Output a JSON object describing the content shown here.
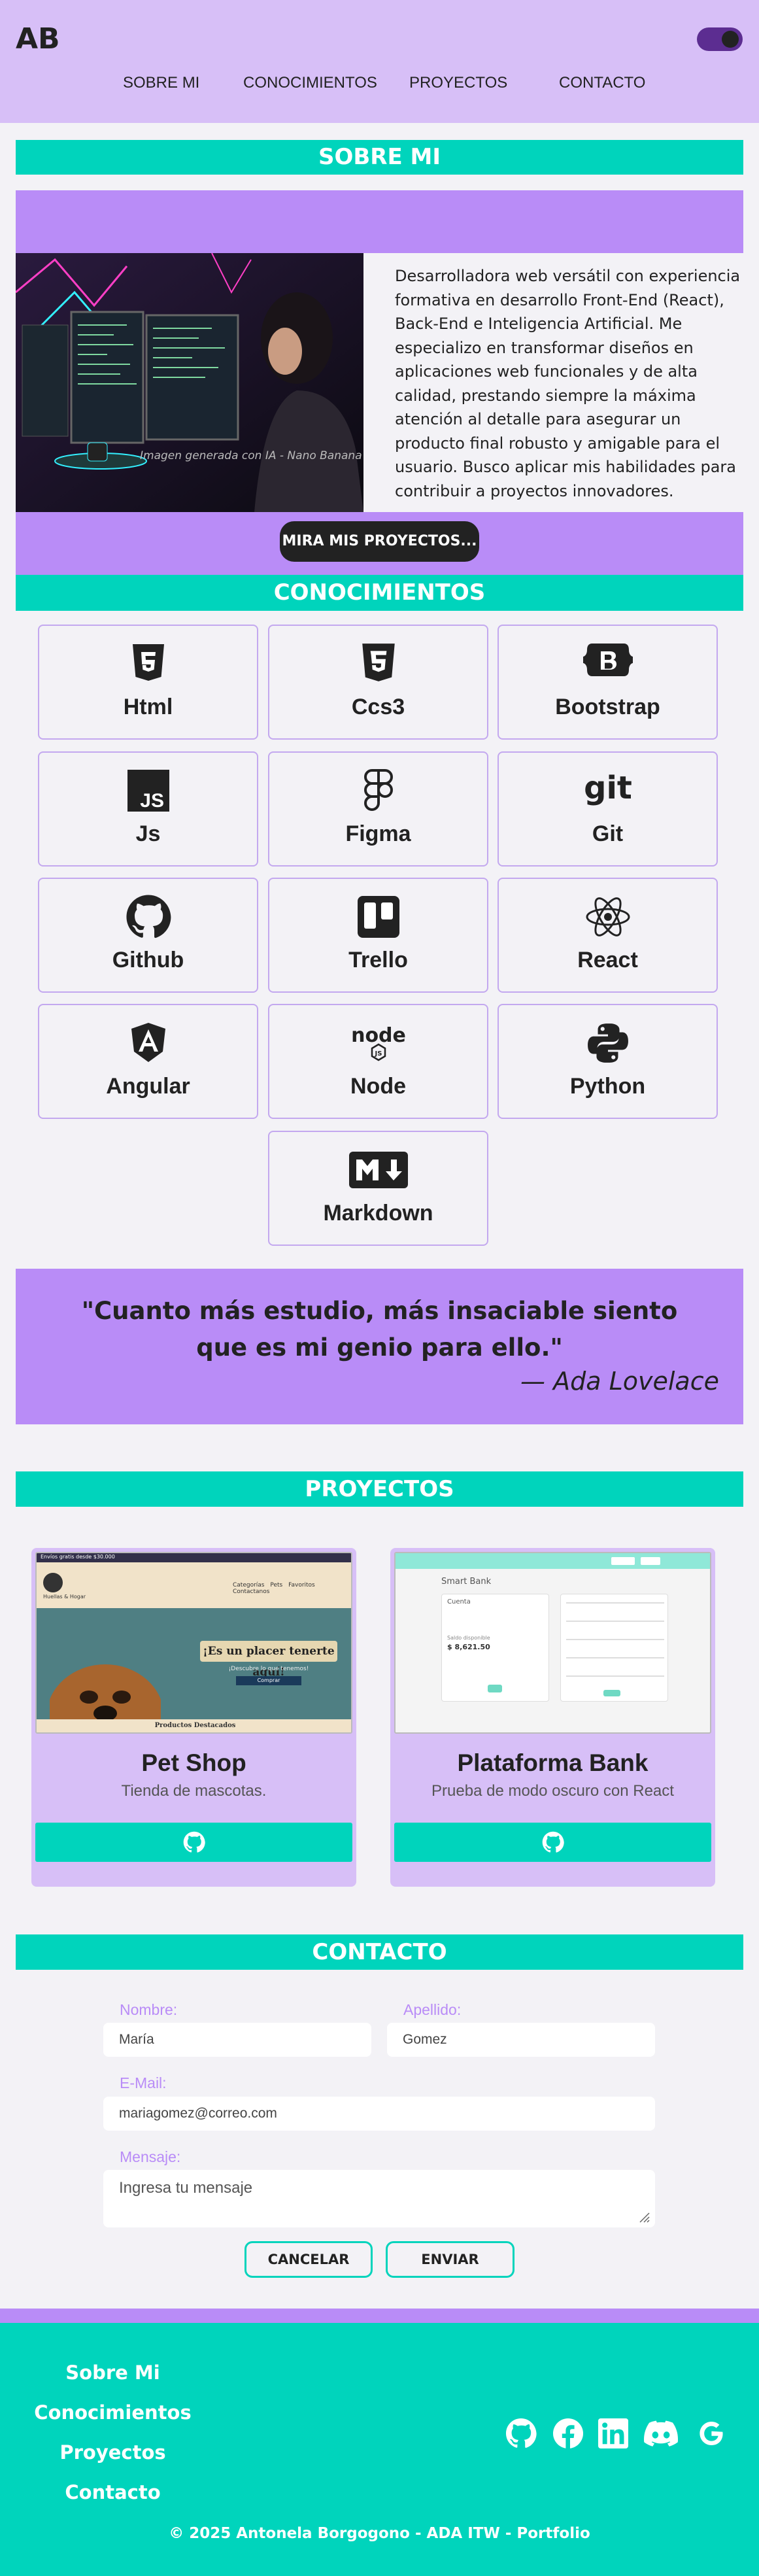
{
  "header": {
    "logo": "AB",
    "nav": [
      "SOBRE MI",
      "CONOCIMIENTOS",
      "PROYECTOS",
      "CONTACTO"
    ]
  },
  "about": {
    "section_title": "SOBRE MI",
    "image_caption": "Imagen generada con IA - Nano Banana",
    "text": "Desarrolladora web versátil con experiencia formativa en desarrollo Front-End (React), Back-End e Inteligencia Artificial. Me especializo en transformar diseños en aplicaciones web funcionales y de alta calidad, prestando siempre la máxima atención al detalle para asegurar un producto final robusto y amigable para el usuario. Busco aplicar mis habilidades para contribuir a proyectos innovadores.",
    "cta": "MIRA MIS PROYECTOS..."
  },
  "skills": {
    "section_title": "CONOCIMIENTOS",
    "items": [
      {
        "label": "Html",
        "icon": "html5-icon"
      },
      {
        "label": "Ccs3",
        "icon": "css3-icon"
      },
      {
        "label": "Bootstrap",
        "icon": "bootstrap-icon"
      },
      {
        "label": "Js",
        "icon": "javascript-icon"
      },
      {
        "label": "Figma",
        "icon": "figma-icon"
      },
      {
        "label": "Git",
        "icon": "git-icon"
      },
      {
        "label": "Github",
        "icon": "github-icon"
      },
      {
        "label": "Trello",
        "icon": "trello-icon"
      },
      {
        "label": "React",
        "icon": "react-icon"
      },
      {
        "label": "Angular",
        "icon": "angular-icon"
      },
      {
        "label": "Node",
        "icon": "node-icon"
      },
      {
        "label": "Python",
        "icon": "python-icon"
      },
      {
        "label": "Markdown",
        "icon": "markdown-icon"
      }
    ]
  },
  "quote": {
    "text": "\"Cuanto más estudio, más insaciable siento que es mi genio para ello.\"",
    "author": "— Ada Lovelace"
  },
  "projects": {
    "section_title": "PROYECTOS",
    "items": [
      {
        "title": "Pet Shop",
        "description": "Tienda de mascotas.",
        "screenshot": {
          "banner": "¡Es un placer tenerte aquí!",
          "sub": "¡Descubre lo que tenemos!",
          "btn": "Comprar",
          "footer": "Productos Destacados",
          "topbar": "Envíos gratis desde $30.000",
          "brand": "Huellas & Hogar",
          "menu": [
            "Categorías",
            "Pets",
            "Favoritos",
            "Contactanos"
          ]
        }
      },
      {
        "title": "Plataforma Bank",
        "description": "Prueba de modo oscuro con React",
        "screenshot": {
          "heading": "Smart Bank",
          "card_title": "Cuenta",
          "saldo_label": "Saldo disponible",
          "saldo": "$ 8,621.50"
        }
      }
    ]
  },
  "contact": {
    "section_title": "CONTACTO",
    "nombre_label": "Nombre:",
    "nombre_value": "María",
    "apellido_label": "Apellido:",
    "apellido_value": "Gomez",
    "email_label": "E-Mail:",
    "email_value": "mariagomez@correo.com",
    "mensaje_label": "Mensaje:",
    "mensaje_placeholder": "Ingresa tu mensaje",
    "cancel": "CANCELAR",
    "send": "ENVIAR"
  },
  "footer": {
    "links": [
      "Sobre Mi",
      "Conocimientos",
      "Proyectos",
      "Contacto"
    ],
    "social": [
      "github-icon",
      "facebook-icon",
      "linkedin-icon",
      "discord-icon",
      "google-icon"
    ],
    "copyright": "© 2025 Antonela Borgogono - ADA ITW - Portfolio"
  },
  "colors": {
    "lavender": "#d7bff7",
    "purple": "#b98cf7",
    "teal": "#00d4bc",
    "dark": "#222222"
  }
}
